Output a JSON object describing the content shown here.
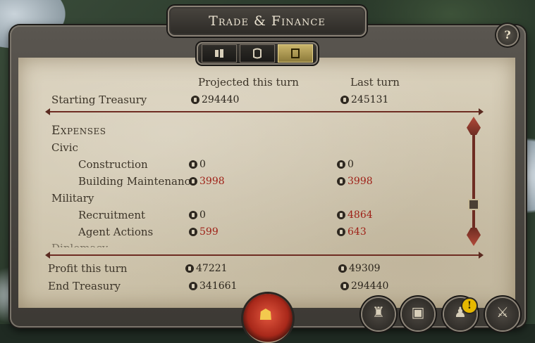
{
  "window": {
    "title": "Trade & Finance",
    "help_label": "?"
  },
  "tabs": [
    {
      "icon": "trade-icon",
      "active": false
    },
    {
      "icon": "scroll-icon",
      "active": false
    },
    {
      "icon": "finance-icon",
      "active": true
    }
  ],
  "columns": {
    "projected": "Projected this turn",
    "last": "Last turn"
  },
  "starting_treasury": {
    "label": "Starting Treasury",
    "projected": "294440",
    "last": "245131"
  },
  "expenses": {
    "title": "Expenses",
    "civic": {
      "label": "Civic",
      "rows": [
        {
          "label": "Construction",
          "projected": "0",
          "last": "0"
        },
        {
          "label": "Building Maintenance",
          "projected": "3998",
          "last": "3998"
        }
      ]
    },
    "military": {
      "label": "Military",
      "rows": [
        {
          "label": "Recruitment",
          "projected": "0",
          "last": "4864"
        },
        {
          "label": "Agent Actions",
          "projected": "599",
          "last": "643"
        }
      ]
    },
    "cut_off_label": "Diplomacy"
  },
  "profit": {
    "label": "Profit this turn",
    "projected": "47221",
    "last": "49309"
  },
  "end_treasury": {
    "label": "End Treasury",
    "projected": "341661",
    "last": "294440"
  },
  "bottom_buttons": {
    "alert_label": "!"
  },
  "colors": {
    "negative": "#9e1f16",
    "text": "#3c3428",
    "parchment": "#d8cfba"
  }
}
